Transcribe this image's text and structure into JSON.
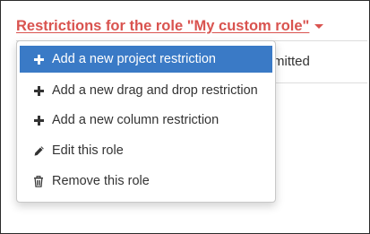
{
  "role_title": "Restrictions for the role \"My custom role\"",
  "background_cell": "mitted",
  "colors": {
    "title_red": "#d9534f",
    "active_blue": "#3a7ac6",
    "text_dark": "#333333"
  },
  "menu": {
    "items": [
      {
        "label": "Add a new project restriction",
        "icon": "plus-icon",
        "active": true
      },
      {
        "label": "Add a new drag and drop restriction",
        "icon": "plus-icon",
        "active": false
      },
      {
        "label": "Add a new column restriction",
        "icon": "plus-icon",
        "active": false
      },
      {
        "label": "Edit this role",
        "icon": "pencil-icon",
        "active": false
      },
      {
        "label": "Remove this role",
        "icon": "trash-icon",
        "active": false
      }
    ]
  }
}
